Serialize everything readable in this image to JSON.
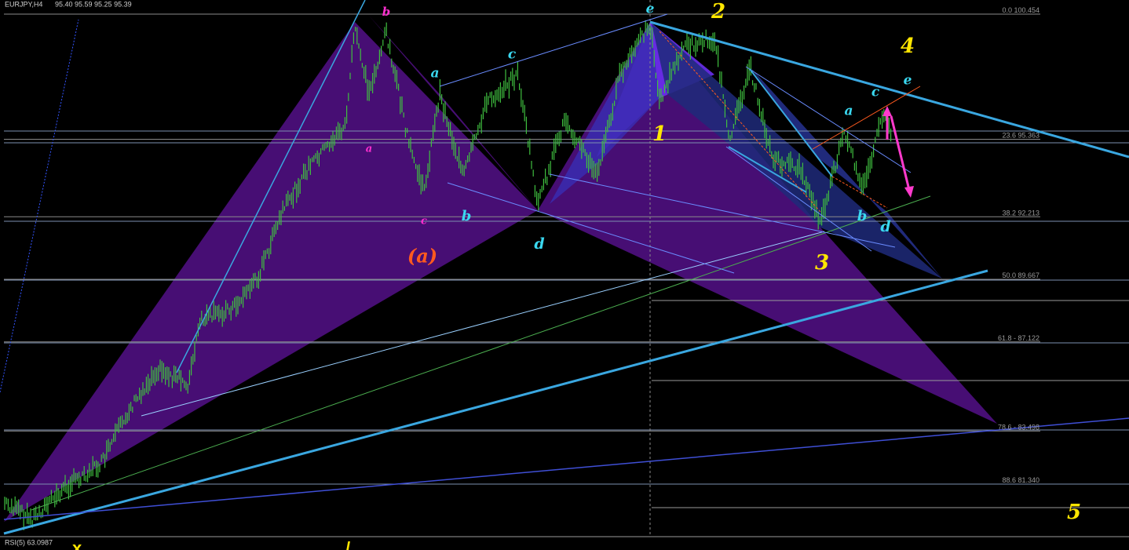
{
  "header": {
    "symbol": "EURJPY,H4",
    "ohlc": "95.40 95.59 95.25 95.39"
  },
  "indicator": {
    "label": "RSI(5) 63.0987"
  },
  "colors": {
    "background": "#000000",
    "candles": "#3fbf3f",
    "harmonic_fill": "#4b0f7a",
    "harmonic_fill_bright": "#6a2ff0",
    "channel_fill": "#1f2a7a",
    "trendline": "#3aa7e0",
    "fib_line": "#8a8a8a",
    "wave_yellow": "#ffe600",
    "wave_cyan": "#3ad8f0",
    "wave_magenta": "#ff2fd0",
    "wave_orange": "#ff5a1f",
    "arrow": "#ff3acc"
  },
  "chart_data": {
    "type": "candlestick",
    "title": "",
    "y_scale": {
      "max": 100.454,
      "min": 77.0
    },
    "fibonacci": [
      {
        "label": "0.0 100.454",
        "price": 100.454
      },
      {
        "label": "23.6 95.363",
        "price": 95.363
      },
      {
        "label": "38.2 92.213",
        "price": 92.213
      },
      {
        "label": "50.0 89.667",
        "price": 89.667
      },
      {
        "label": "61.8 - 87.122",
        "price": 87.122
      },
      {
        "label": "78.6 - 83.498",
        "price": 83.498
      },
      {
        "label": "88.6 81.340",
        "price": 81.34
      }
    ],
    "wave_labels": [
      {
        "text": "b",
        "color": "magenta",
        "size": 15
      },
      {
        "text": "a",
        "color": "magenta",
        "size": 13
      },
      {
        "text": "c",
        "color": "magenta",
        "size": 13
      },
      {
        "text": "(a)",
        "color": "orange",
        "size": 24
      },
      {
        "text": "a",
        "color": "cyan",
        "size": 17
      },
      {
        "text": "b",
        "color": "cyan",
        "size": 18
      },
      {
        "text": "c",
        "color": "cyan",
        "size": 17
      },
      {
        "text": "d",
        "color": "cyan",
        "size": 19
      },
      {
        "text": "e",
        "color": "cyan",
        "size": 17
      },
      {
        "text": "1",
        "color": "yellow",
        "size": 26
      },
      {
        "text": "2",
        "color": "yellow",
        "size": 26
      },
      {
        "text": "3",
        "color": "yellow",
        "size": 26
      },
      {
        "text": "4",
        "color": "yellow",
        "size": 26
      },
      {
        "text": "5",
        "color": "yellow",
        "size": 26
      },
      {
        "text": "a",
        "color": "cyan",
        "size": 17
      },
      {
        "text": "b",
        "color": "cyan",
        "size": 18
      },
      {
        "text": "c",
        "color": "cyan",
        "size": 17
      },
      {
        "text": "d",
        "color": "cyan",
        "size": 19
      },
      {
        "text": "e",
        "color": "cyan",
        "size": 17
      }
    ]
  }
}
